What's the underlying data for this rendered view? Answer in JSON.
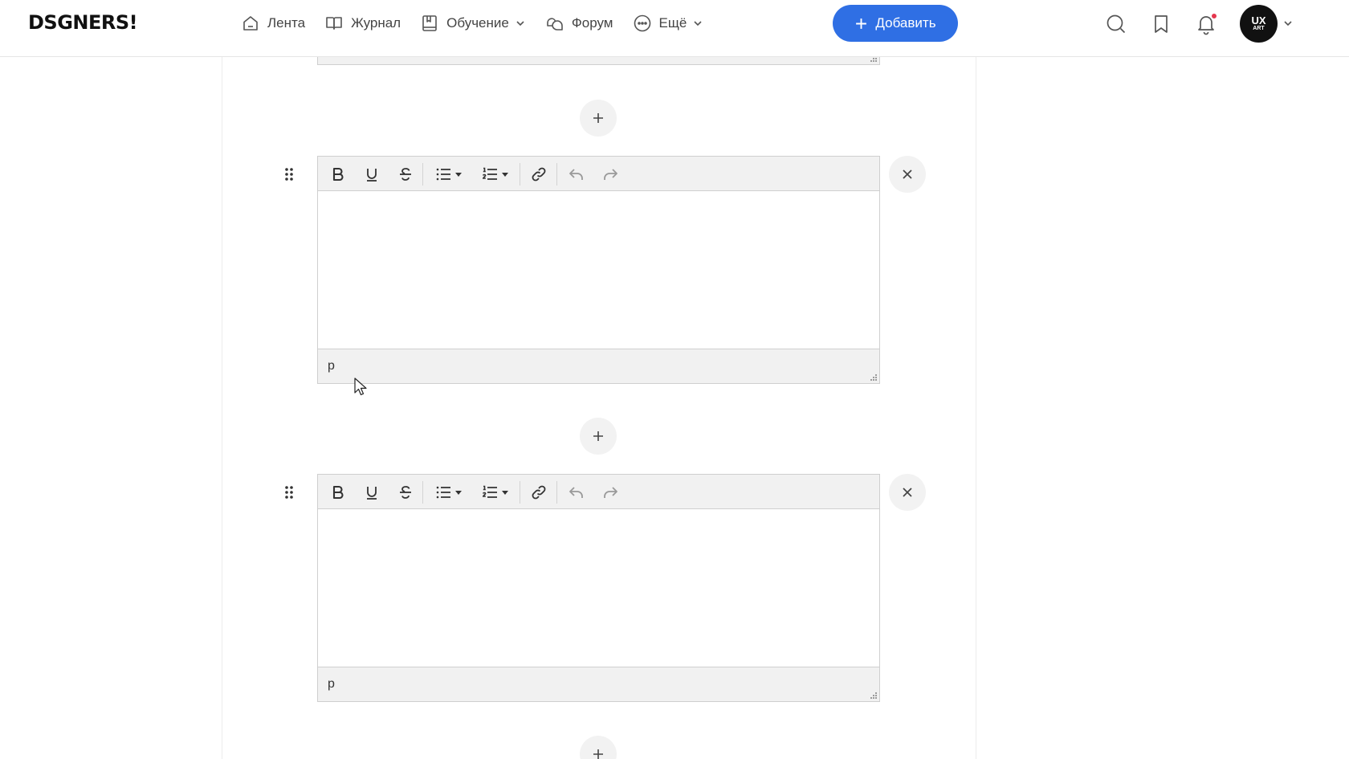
{
  "header": {
    "logo": "DSGNERS!",
    "nav": [
      {
        "label": "Лента",
        "icon": "home-icon"
      },
      {
        "label": "Журнал",
        "icon": "book-icon"
      },
      {
        "label": "Обучение",
        "icon": "learning-icon",
        "has_dropdown": true
      },
      {
        "label": "Форум",
        "icon": "forum-icon"
      },
      {
        "label": "Ещё",
        "icon": "more-icon",
        "has_dropdown": true
      }
    ],
    "add_button": "Добавить",
    "icons": [
      "search-icon",
      "bookmark-icon",
      "bell-icon"
    ],
    "avatar": {
      "line1": "UX",
      "line2": "ART"
    }
  },
  "colors": {
    "accent": "#2f6fe4",
    "notification": "#e5364f",
    "toolbar_bg": "#f1f1f1",
    "border": "#cfcfcf"
  },
  "editors": [
    {
      "toolbar": [
        "bold",
        "underline",
        "strikethrough",
        "bullet-list",
        "numbered-list",
        "link",
        "undo",
        "redo"
      ],
      "content": "",
      "path": "p"
    },
    {
      "toolbar": [
        "bold",
        "underline",
        "strikethrough",
        "bullet-list",
        "numbered-list",
        "link",
        "undo",
        "redo"
      ],
      "content": "",
      "path": "p"
    }
  ]
}
